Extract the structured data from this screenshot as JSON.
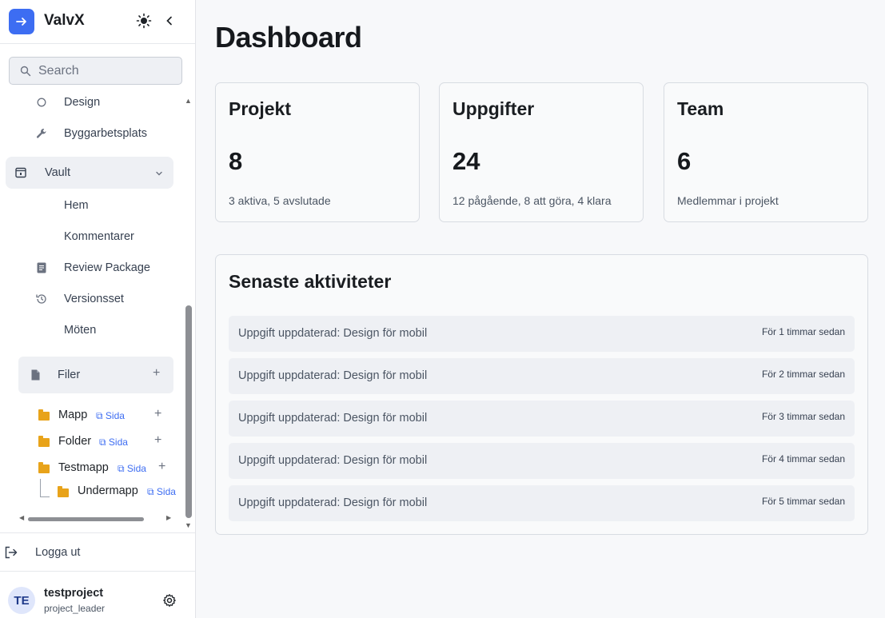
{
  "app": {
    "name": "ValvX"
  },
  "search": {
    "placeholder": "Search"
  },
  "nav": {
    "design": "Design",
    "byggarbetsplats": "Byggarbetsplats",
    "vault": "Vault",
    "hem": "Hem",
    "kommentarer": "Kommentarer",
    "review_package": "Review Package",
    "versionsset": "Versionsset",
    "moten": "Möten",
    "filer": "Filer"
  },
  "folders": [
    {
      "name": "Mapp",
      "link": "Sida"
    },
    {
      "name": "Folder",
      "link": "Sida"
    },
    {
      "name": "Testmapp",
      "link": "Sida"
    },
    {
      "name": "Undermapp",
      "link": "Sida"
    }
  ],
  "logout": {
    "label": "Logga ut"
  },
  "user": {
    "initials": "TE",
    "name": "testproject",
    "role": "project_leader"
  },
  "page": {
    "title": "Dashboard"
  },
  "stats": [
    {
      "title": "Projekt",
      "value": "8",
      "desc": "3 aktiva, 5 avslutade"
    },
    {
      "title": "Uppgifter",
      "value": "24",
      "desc": "12 pågående, 8 att göra, 4 klara"
    },
    {
      "title": "Team",
      "value": "6",
      "desc": "Medlemmar i projekt"
    }
  ],
  "activity": {
    "title": "Senaste aktiviteter",
    "items": [
      {
        "text": "Uppgift uppdaterad: Design för mobil",
        "time": "För 1 timmar sedan"
      },
      {
        "text": "Uppgift uppdaterad: Design för mobil",
        "time": "För 2 timmar sedan"
      },
      {
        "text": "Uppgift uppdaterad: Design för mobil",
        "time": "För 3 timmar sedan"
      },
      {
        "text": "Uppgift uppdaterad: Design för mobil",
        "time": "För 4 timmar sedan"
      },
      {
        "text": "Uppgift uppdaterad: Design för mobil",
        "time": "För 5 timmar sedan"
      }
    ]
  },
  "colors": {
    "accent": "#3d6df2",
    "folder": "#e8a31a"
  }
}
